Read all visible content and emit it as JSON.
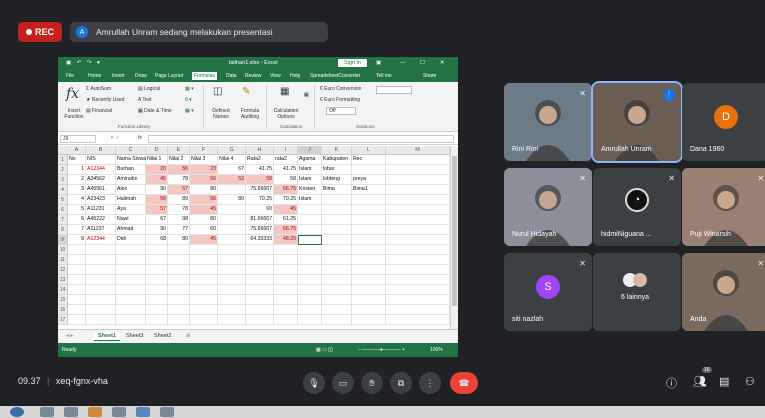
{
  "meeting": {
    "rec_label": "REC",
    "presenter_initial": "A",
    "presenting_text": "Amrullah Unram sedang melakukan presentasi",
    "time": "09.37",
    "meeting_code": "xeq-fgnx-vha",
    "participants_badge": "16"
  },
  "excel": {
    "filename": "latihan1.xlsx - Excel",
    "sign_in": "Sign in",
    "tabs": [
      "File",
      "Home",
      "Insert",
      "Draw",
      "Page Layout",
      "Formulas",
      "Data",
      "Review",
      "View",
      "Help",
      "SpreadsheetConverter",
      "Tell me",
      "Share"
    ],
    "active_tab": "Formulas",
    "ribbon": {
      "insert_function": "Insert Function",
      "autosum": "AutoSum",
      "recently_used": "Recently Used",
      "financial": "Financial",
      "logical": "Logical",
      "text": "Text",
      "date_time": "Date & Time",
      "defined_names": "Defined Names",
      "formula_auditing": "Formula Auditing",
      "calculation_options": "Calculation Options",
      "euro_conversion": "Euro Conversion",
      "euro_formatting": "Euro Formatting",
      "euro_off": "Off",
      "group_function_library": "Function Library",
      "group_calculation": "Calculation",
      "group_solutions": "Solutions"
    },
    "name_box": "J9",
    "fx": "fx",
    "columns": [
      "A",
      "B",
      "C",
      "D",
      "E",
      "F",
      "G",
      "H",
      "I",
      "J",
      "K",
      "L",
      "M"
    ],
    "rows": [
      "1",
      "2",
      "3",
      "4",
      "5",
      "6",
      "7",
      "8",
      "9",
      "10",
      "11",
      "12",
      "13",
      "14",
      "15",
      "16",
      "17"
    ],
    "headers": [
      "No",
      "NIS",
      "Nama Siswa",
      "Nilai 1",
      "Nilai 2",
      "Nilai 3",
      "Nilai 4",
      "Rata2",
      "rata2",
      "Agama",
      "Kabupaten",
      "Rec"
    ],
    "data": [
      {
        "no": "1",
        "nis": "A12344",
        "nama": "Burhan",
        "n1": "20",
        "n2": "56",
        "n3": "23",
        "n4": "67",
        "r1": "41.75",
        "r2": "41.75",
        "agama": "Islam",
        "kab": "lobar",
        "rec": ""
      },
      {
        "no": "2",
        "nis": "A34562",
        "nama": "Amirudin",
        "n1": "45",
        "n2": "78",
        "n3": "56",
        "n4": "53",
        "r1": "58",
        "r2": "58",
        "agama": "Islam",
        "kab": "lobteng",
        "rec": "preya"
      },
      {
        "no": "3",
        "nis": "A45561",
        "nama": "Alex",
        "n1": "90",
        "n2": "57",
        "n3": "80",
        "n4": "",
        "r1": "75.66667",
        "r2": "56.75",
        "agama": "Kristen",
        "kab": "Bima",
        "rec": "Bima1"
      },
      {
        "no": "4",
        "nis": "A23423",
        "nama": "Halimah",
        "n1": "56",
        "n2": "89",
        "n3": "56",
        "n4": "80",
        "r1": "70.25",
        "r2": "70.25",
        "agama": "Islam",
        "kab": "",
        "rec": ""
      },
      {
        "no": "5",
        "nis": "A11231",
        "nama": "Aya",
        "n1": "57",
        "n2": "78",
        "n3": "45",
        "n4": "",
        "r1": "60",
        "r2": "45",
        "agama": "",
        "kab": "",
        "rec": ""
      },
      {
        "no": "6",
        "nis": "A45222",
        "nama": "Nawi",
        "n1": "67",
        "n2": "98",
        "n3": "80",
        "n4": "",
        "r1": "81.66667",
        "r2": "61.25",
        "agama": "",
        "kab": "",
        "rec": ""
      },
      {
        "no": "7",
        "nis": "A11237",
        "nama": "Ahmad",
        "n1": "90",
        "n2": "77",
        "n3": "60",
        "n4": "",
        "r1": "75.66667",
        "r2": "56.75",
        "agama": "",
        "kab": "",
        "rec": ""
      },
      {
        "no": "8",
        "nis": "A12344",
        "nama": "Didi",
        "n1": "68",
        "n2": "80",
        "n3": "45",
        "n4": "",
        "r1": "64.33333",
        "r2": "48.25",
        "agama": "",
        "kab": "",
        "rec": ""
      }
    ],
    "sheet_tabs": [
      "Sheet1",
      "Sheet3",
      "Sheet2"
    ],
    "active_sheet": "Sheet1",
    "status_left": "Ready",
    "zoom": "100%"
  },
  "participants": [
    {
      "name": "Rini Rini",
      "type": "photo",
      "color": "#6d7a88"
    },
    {
      "name": "Amrullah Unram",
      "type": "photo",
      "color": "#6b5e55",
      "active": true
    },
    {
      "name": "Dana 1960",
      "type": "avatar",
      "initial": "D",
      "color": "#e8710a"
    },
    {
      "name": "Nurul Hidayah",
      "type": "photo",
      "color": "#8a8f99"
    },
    {
      "name": "hidmiNiguana ...",
      "type": "logo",
      "color": "#3c4043"
    },
    {
      "name": "Puji Winarsih",
      "type": "photo",
      "color": "#9a7f74"
    },
    {
      "name": "siti nazlah",
      "type": "avatar",
      "initial": "S",
      "color": "#a142f4"
    },
    {
      "name": "6 lainnya",
      "type": "group",
      "color": "#3c4043"
    },
    {
      "name": "Anda",
      "type": "photo",
      "color": "#7a6a60"
    }
  ],
  "colors": {
    "excel_green": "#217346",
    "meet_bg": "#202124",
    "tile_bg": "#3c4043",
    "rec_red": "#c5221f",
    "end_call": "#ea4335",
    "highlight": "#f4c7c3"
  },
  "icons": [
    "mic-off-icon",
    "mic-icon",
    "camera-icon",
    "raise-hand-icon",
    "present-icon",
    "more-icon",
    "end-call-icon",
    "info-icon",
    "people-icon",
    "chat-icon",
    "activities-icon"
  ]
}
